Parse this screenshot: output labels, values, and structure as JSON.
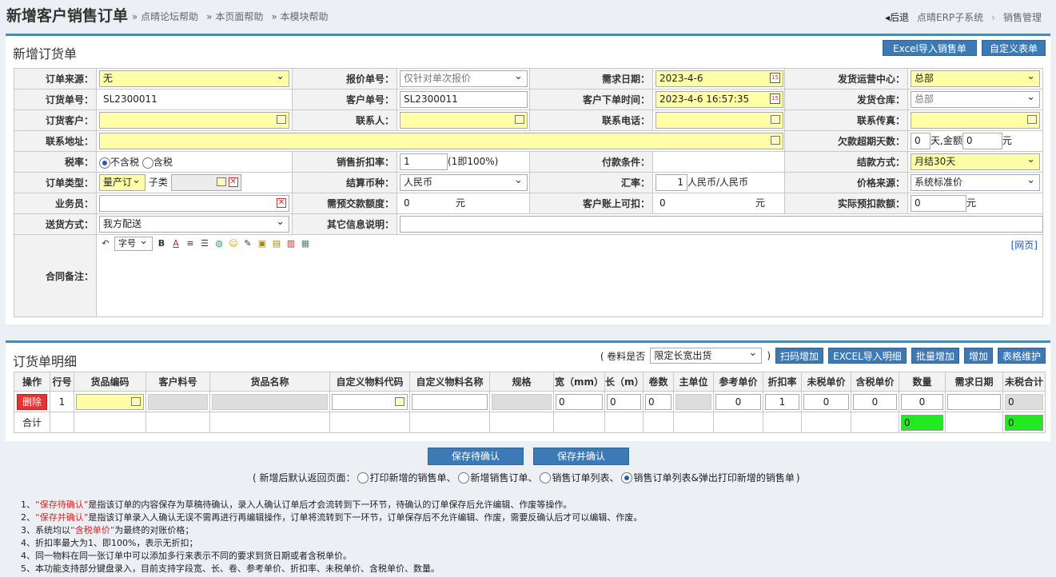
{
  "header": {
    "title": "新增客户销售订单",
    "help_links": [
      "» 点晴论坛帮助",
      "» 本页面帮助",
      "» 本模块帮助"
    ],
    "back": "后退",
    "crumb1": "点晴ERP子系统",
    "crumb_sep": "›",
    "crumb2": "销售管理"
  },
  "order_panel": {
    "title": "新增订货单",
    "btn_excel_import": "Excel导入销售单",
    "btn_custom_form": "自定义表单",
    "labels": {
      "order_source": "订单来源：",
      "quote_no": "报价单号：",
      "demand_date": "需求日期：",
      "ship_center": "发货运营中心：",
      "order_no": "订货单号：",
      "customer_no": "客户单号：",
      "customer_order_time": "客户下单时间：",
      "ship_warehouse": "发货仓库：",
      "order_customer": "订货客户：",
      "contact": "联系人：",
      "phone": "联系电话：",
      "fax": "联系传真：",
      "address": "联系地址：",
      "overdue_days": "欠款超期天数：",
      "tax_rate": "税率：",
      "discount": "销售折扣率：",
      "payment_terms": "付款条件：",
      "settle_method": "结款方式：",
      "order_type": "订单类型：",
      "settle_currency": "结算币种：",
      "exchange_rate": "汇率：",
      "price_source": "价格来源：",
      "salesman": "业务员：",
      "prepay_amount": "需预交款额度：",
      "customer_credit": "客户账上可扣：",
      "actual_prepay": "实际预扣款额：",
      "delivery_method": "送货方式：",
      "other_info": "其它信息说明：",
      "contract_note": "合同备注："
    },
    "values": {
      "order_source": "无",
      "quote_no": "仅针对单次报价",
      "demand_date": "2023-4-6",
      "ship_center": "总部",
      "order_no": "SL2300011",
      "customer_no": "SL2300011",
      "customer_order_time": "2023-4-6 16:57:35",
      "ship_warehouse": "总部",
      "overdue_days": "0",
      "overdue_days_unit": "天,金额",
      "overdue_amount": "0",
      "overdue_amount_unit": "元",
      "tax_excl": "不含税",
      "tax_incl": "含税",
      "discount": "1",
      "discount_hint": "(1即100%)",
      "settle_method": "月结30天",
      "order_type": "量产订",
      "order_subtype_label": "子类",
      "settle_currency": "人民币",
      "exchange_rate": "1",
      "exchange_rate_unit": "人民币/人民币",
      "price_source": "系统标准价",
      "prepay_amount": "0",
      "prepay_unit": "元",
      "customer_credit": "0",
      "customer_credit_unit": "元",
      "actual_prepay": "0",
      "actual_prepay_unit": "元",
      "delivery_method": "我方配送",
      "font_size_select": "字号",
      "web_link": "[网页]"
    }
  },
  "detail_panel": {
    "title": "订货单明细",
    "roll_label": "( 卷料是否",
    "roll_select": "限定长宽出货",
    "roll_close": ")",
    "buttons": [
      "扫码增加",
      "EXCEL导入明细",
      "批量增加",
      "增加",
      "表格维护"
    ],
    "columns": [
      "操作",
      "行号",
      "货品编码",
      "客户料号",
      "货品名称",
      "自定义物料代码",
      "自定义物料名称",
      "规格",
      "宽（mm）",
      "长（m）",
      "卷数",
      "主单位",
      "参考单价",
      "折扣率",
      "未税单价",
      "含税单价",
      "数量",
      "需求日期",
      "未税合计"
    ],
    "row": {
      "delete": "删除",
      "line_no": "1",
      "width": "0",
      "length": "0",
      "rolls": "0",
      "ref_price": "0",
      "discount": "1",
      "untaxed_price": "0",
      "taxed_price": "0",
      "qty": "0",
      "untaxed_total": "0"
    },
    "total_row": {
      "label": "合计",
      "qty_total": "0",
      "untaxed_total": "0"
    }
  },
  "actions": {
    "save_pending": "保存待确认",
    "save_confirm": "保存并确认",
    "return_prefix": "( 新增后默认返回页面：",
    "return_opts": [
      "打印新增的销售单、",
      "新增销售订单、",
      "销售订单列表、",
      "销售订单列表&弹出打印新增的销售单"
    ],
    "return_suffix": ")"
  },
  "notes": [
    {
      "pre": "1、",
      "red": "“保存待确认”",
      "post": "是指该订单的内容保存为草稿待确认，录入人确认订单后才会流转到下一环节，待确认的订单保存后允许编辑、作废等操作。"
    },
    {
      "pre": "2、",
      "red": "“保存并确认”",
      "post": "是指该订单录入人确认无误不需再进行再编辑操作，订单将流转到下一环节，订单保存后不允许编辑、作废，需要反确认后才可以编辑、作废。"
    },
    {
      "pre": "3、系统均以",
      "red": "“含税单价”",
      "post": "为最终的对账价格；"
    },
    {
      "pre": "4、折扣率最大为1、即100%，表示无折扣；",
      "red": "",
      "post": ""
    },
    {
      "pre": "4、同一物料在同一张订单中可以添加多行来表示不同的要求到货日期或者含税单价。",
      "red": "",
      "post": ""
    },
    {
      "pre": "5、本功能支持部分键盘录入，目前支持字段宽、长、卷、参考单价、折扣率、未税单价、含税单价、数量。",
      "red": "",
      "post": ""
    }
  ]
}
